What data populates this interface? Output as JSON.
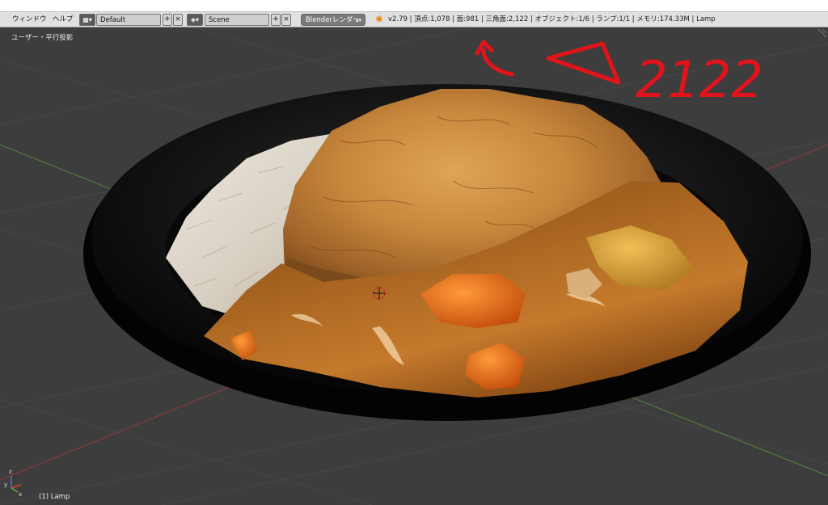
{
  "menu": {
    "window": "ウィンドウ",
    "help": "ヘルプ"
  },
  "screen_layout": {
    "icon": "screen-layout-icon",
    "name": "Default"
  },
  "scene": {
    "icon": "scene-icon",
    "name": "Scene"
  },
  "buttons": {
    "add": "+",
    "remove": "×"
  },
  "render_engine": {
    "label": "Blenderレンダー",
    "icon": "updown-arrows-icon"
  },
  "blender_logo": {
    "icon": "blender-logo-icon"
  },
  "stats": "v2.79 | 頂点:1,078 | 面:981 | 三角面:2,122 | オブジェクト:1/6 | ランプ:1/1 | メモリ:174.33M | Lamp",
  "viewport": {
    "view_label": "ユーザー・平行投影",
    "object_label": "(1) Lamp",
    "cursor_icon": "3d-cursor-icon",
    "axis_gizmo_icon": "axis-gizmo-icon",
    "axis_labels": {
      "x": "x",
      "y": "y",
      "z": "z"
    }
  },
  "annotation": {
    "text": "2122",
    "icon": "triangle-icon",
    "arrow_icon": "arrow-up-icon",
    "color": "#e0141a"
  },
  "colors": {
    "header_bg": "#e0e0e0",
    "viewport_bg": "#3d3d3d",
    "grid_line": "#474747",
    "x_axis": "#8a3a3a",
    "y_axis": "#4f7a3c",
    "plate": "#0a0a0a"
  }
}
